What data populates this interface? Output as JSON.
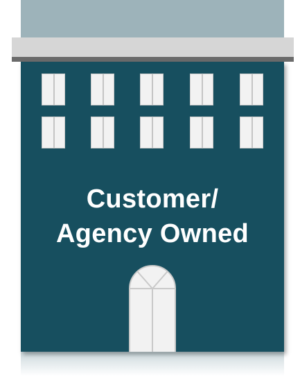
{
  "building": {
    "label_line1": "Customer/",
    "label_line2": "Agency Owned",
    "window_rows": 2,
    "window_columns": 5,
    "colors": {
      "facade": "#174f5f",
      "roof": "#9db3ba",
      "ledge": "#d6d6d6",
      "trim": "#6b6b6b",
      "window": "#f2f2f2",
      "text": "#ffffff"
    }
  }
}
